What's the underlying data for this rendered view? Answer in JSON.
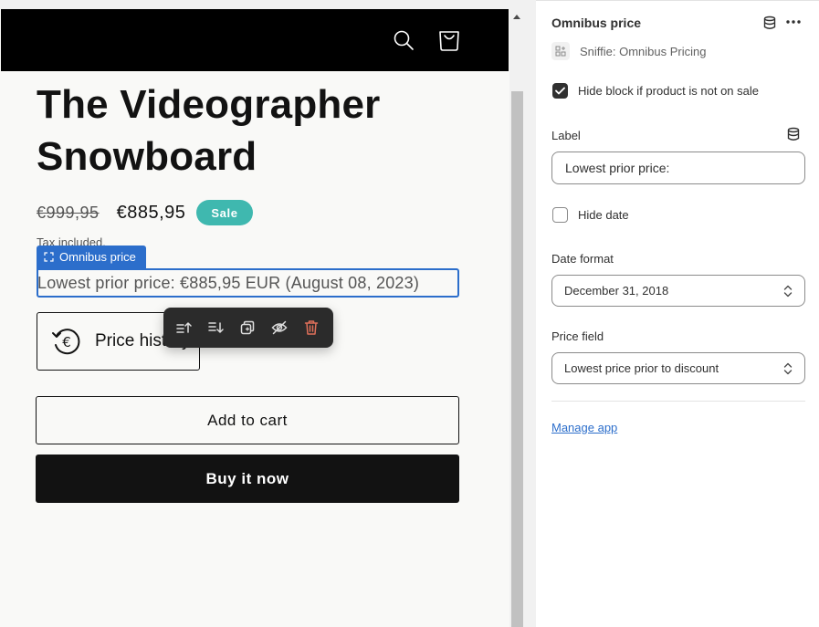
{
  "product": {
    "title": "The Videographer Snowboard",
    "compare_price": "€999,95",
    "sale_price": "€885,95",
    "sale_badge": "Sale",
    "tax_note": "Tax included.",
    "omnibus_tag": "Omnibus price",
    "omnibus_text": "Lowest prior price: €885,95 EUR (August 08, 2023)",
    "price_history_label": "Price history",
    "add_to_cart": "Add to cart",
    "buy_now": "Buy it now"
  },
  "header": {
    "icons": [
      "search-icon",
      "cart-icon"
    ]
  },
  "toolbar": {
    "icons": [
      "move-up-icon",
      "move-down-icon",
      "duplicate-icon",
      "hide-icon",
      "delete-icon"
    ]
  },
  "settings": {
    "title": "Omnibus price",
    "app_name": "Sniffie: Omnibus Pricing",
    "hide_block": {
      "label": "Hide block if product is not on sale",
      "checked": true
    },
    "label_field": {
      "label": "Label",
      "value": "Lowest prior price:"
    },
    "hide_date": {
      "label": "Hide date",
      "checked": false
    },
    "date_format": {
      "label": "Date format",
      "value": "December 31, 2018"
    },
    "price_field": {
      "label": "Price field",
      "value": "Lowest price prior to discount"
    },
    "manage_app": "Manage app"
  },
  "colors": {
    "sale_badge": "#3fb8af",
    "selection_blue": "#2c6ecb",
    "delete_red": "#e0705a",
    "header_bg": "#000000"
  }
}
